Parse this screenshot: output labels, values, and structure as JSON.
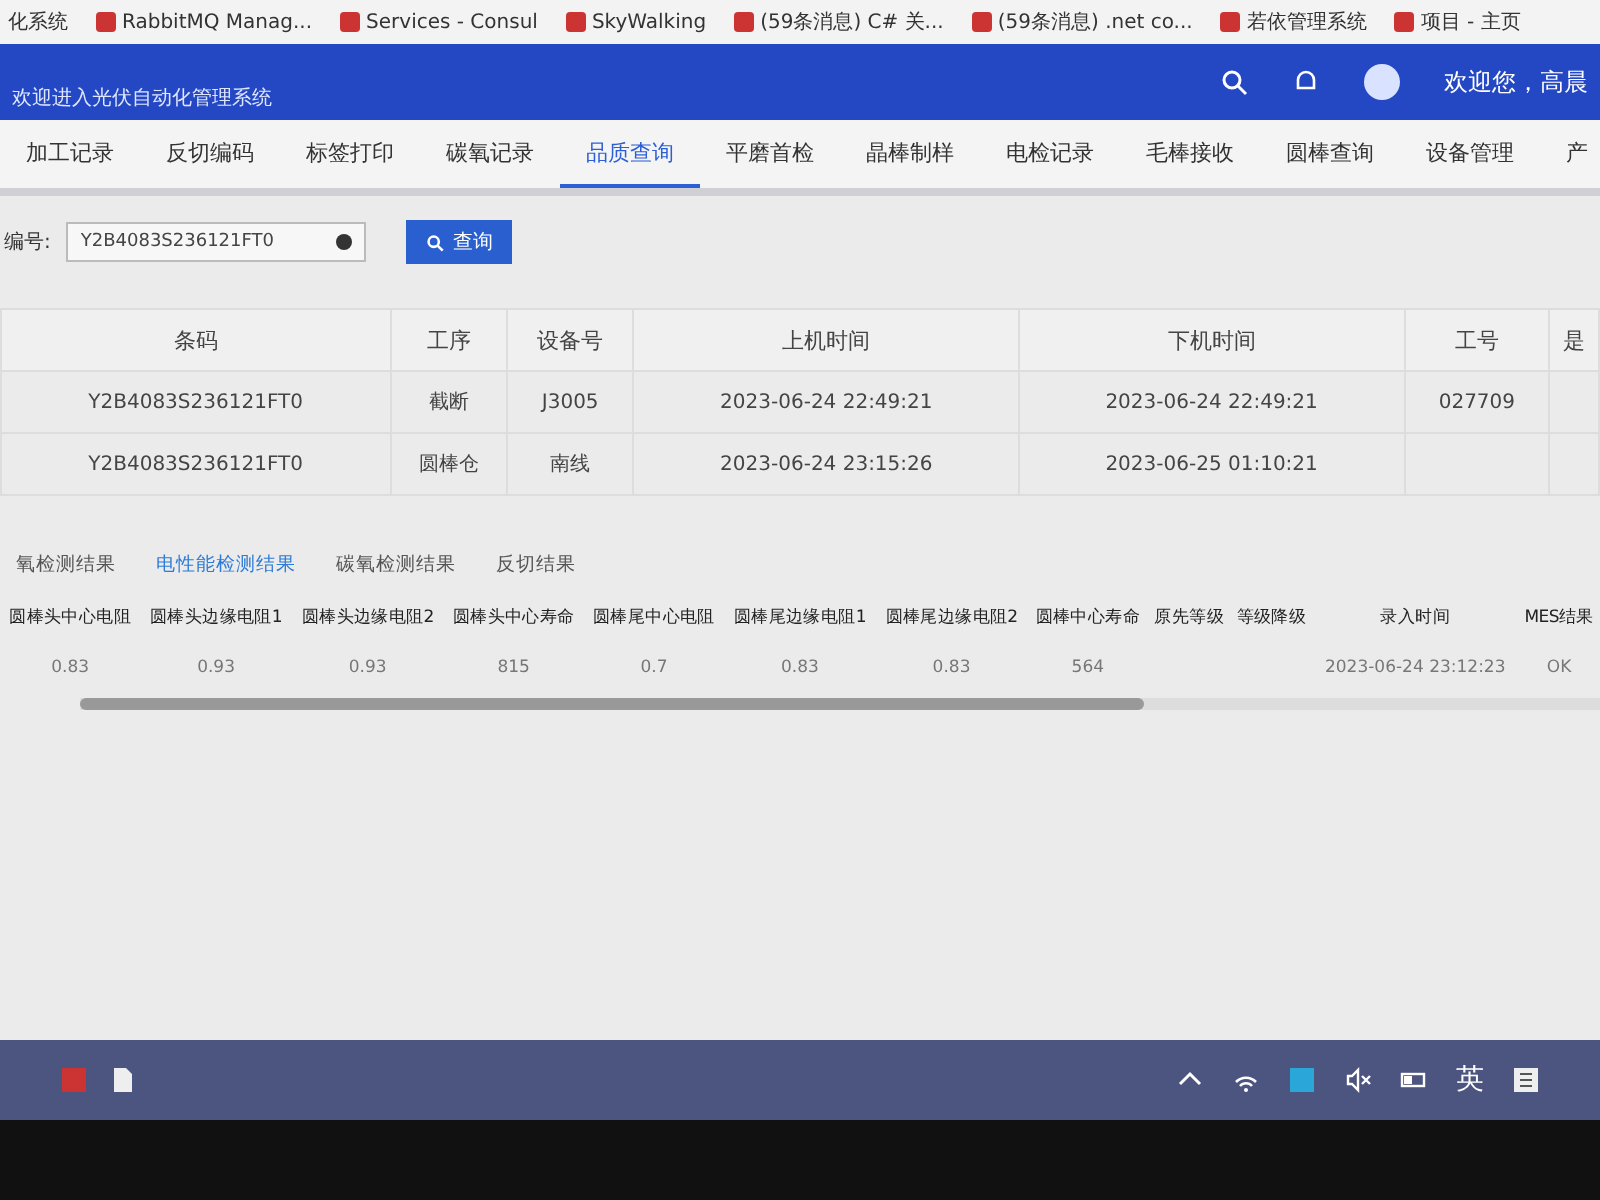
{
  "bookmarks": [
    {
      "label": "化系统"
    },
    {
      "label": "RabbitMQ Manag..."
    },
    {
      "label": "Services - Consul"
    },
    {
      "label": "SkyWalking"
    },
    {
      "label": "(59条消息) C# 关..."
    },
    {
      "label": "(59条消息) .net co..."
    },
    {
      "label": "若依管理系统"
    },
    {
      "label": "项目 - 主页"
    }
  ],
  "header": {
    "title": "欢迎进入光伏自动化管理系统",
    "greeting": "欢迎您，高晨"
  },
  "nav": [
    {
      "label": "加工记录",
      "selected": false
    },
    {
      "label": "反切编码",
      "selected": false
    },
    {
      "label": "标签打印",
      "selected": false
    },
    {
      "label": "碳氧记录",
      "selected": false
    },
    {
      "label": "品质查询",
      "selected": true
    },
    {
      "label": "平磨首检",
      "selected": false
    },
    {
      "label": "晶棒制样",
      "selected": false
    },
    {
      "label": "电检记录",
      "selected": false
    },
    {
      "label": "毛棒接收",
      "selected": false
    },
    {
      "label": "圆棒查询",
      "selected": false
    },
    {
      "label": "设备管理",
      "selected": false
    },
    {
      "label": "产",
      "selected": false
    }
  ],
  "search": {
    "label": "编号:",
    "value": "Y2B4083S236121FT0",
    "button": "查询"
  },
  "process_table": {
    "columns": [
      "条码",
      "工序",
      "设备号",
      "上机时间",
      "下机时间",
      "工号",
      "是"
    ],
    "rows": [
      [
        "Y2B4083S236121FT0",
        "截断",
        "J3005",
        "2023-06-24 22:49:21",
        "2023-06-24 22:49:21",
        "027709",
        ""
      ],
      [
        "Y2B4083S236121FT0",
        "圆棒仓",
        "南线",
        "2023-06-24 23:15:26",
        "2023-06-25 01:10:21",
        "",
        ""
      ]
    ]
  },
  "result_tabs": [
    {
      "label": "氧检测结果",
      "selected": false
    },
    {
      "label": "电性能检测结果",
      "selected": true
    },
    {
      "label": "碳氧检测结果",
      "selected": false
    },
    {
      "label": "反切结果",
      "selected": false
    }
  ],
  "result_table": {
    "columns": [
      "圆棒头中心电阻",
      "圆棒头边缘电阻1",
      "圆棒头边缘电阻2",
      "圆棒头中心寿命",
      "圆棒尾中心电阻",
      "圆棒尾边缘电阻1",
      "圆棒尾边缘电阻2",
      "圆棒中心寿命",
      "原先等级",
      "等级降级",
      "录入时间",
      "MES结果"
    ],
    "rows": [
      [
        "0.83",
        "0.93",
        "0.93",
        "815",
        "0.7",
        "0.83",
        "0.83",
        "564",
        "",
        "",
        "2023-06-24 23:12:23",
        "OK"
      ]
    ]
  },
  "taskbar": {
    "ime": "英"
  }
}
